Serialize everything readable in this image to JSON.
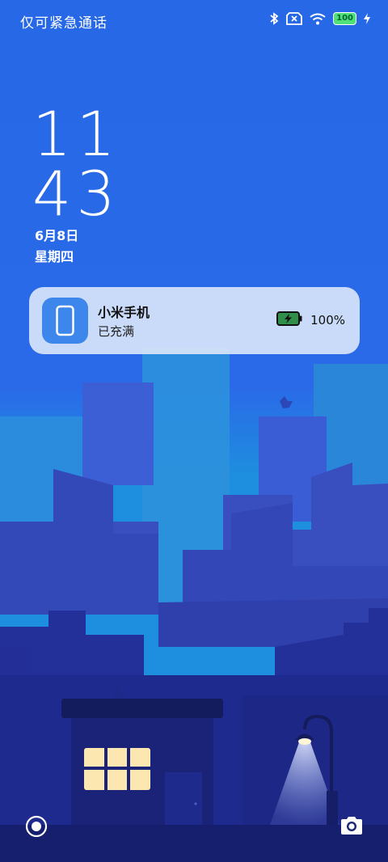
{
  "status_bar": {
    "carrier_text": "仅可紧急通话",
    "battery_level": "100",
    "icons": [
      "bluetooth-icon",
      "no-sim-icon",
      "wifi-icon",
      "battery-icon",
      "charging-bolt-icon"
    ]
  },
  "clock": {
    "hours": "11",
    "minutes": "43",
    "date": "6月8日",
    "weekday": "星期四"
  },
  "notification": {
    "title": "小米手机",
    "subtitle": "已充满",
    "battery_percent": "100%",
    "icon": "phone-icon",
    "battery_icon": "battery-charging-icon"
  },
  "shortcuts": {
    "left_icon": "assistant-circle-icon",
    "right_icon": "camera-icon"
  },
  "colors": {
    "sky_top": "#2668e6",
    "sky_mid": "#1e8ede",
    "window_light": "#fde7b0",
    "notification_bg": "#d6e4fa",
    "app_icon_bg": "#3c86ec"
  }
}
